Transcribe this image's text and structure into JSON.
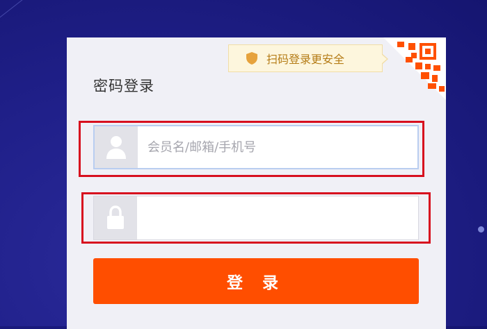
{
  "login": {
    "title": "密码登录",
    "qr_tip": "扫码登录更安全",
    "username_placeholder": "会员名/邮箱/手机号",
    "password_value": "",
    "submit_label": "登 录"
  },
  "icons": {
    "shield": "shield-icon",
    "qr": "qr-code-icon",
    "user": "user-icon",
    "lock": "lock-icon"
  },
  "colors": {
    "accent": "#ff4e00",
    "highlight": "#d70f1e",
    "tip_bg": "#fdf6dd",
    "tip_text": "#b57c16",
    "shield": "#e6a23c",
    "qr": "#ff5000"
  }
}
